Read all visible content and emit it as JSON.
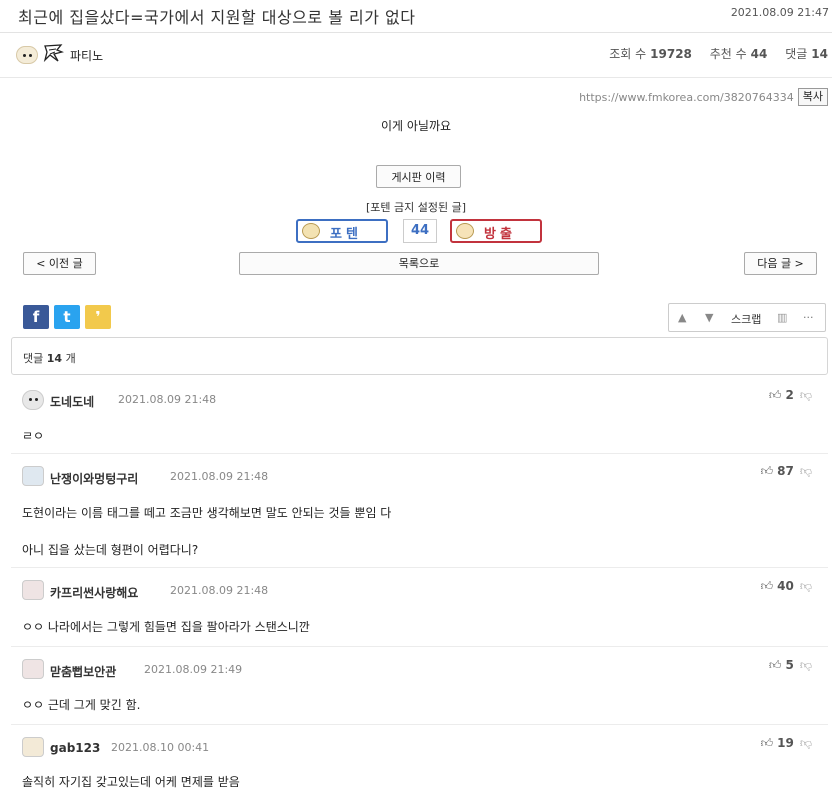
{
  "post": {
    "title": "최근에 집을샀다=국가에서 지원할 대상으로 볼 리가 없다",
    "date": "2021.08.09 21:47",
    "author": "파티노",
    "stats": {
      "views_label": "조회 수",
      "views": "19728",
      "recommend_label": "추천 수",
      "recommend": "44",
      "comments_label": "댓글",
      "comments": "14"
    },
    "url": "https://www.fmkorea.com/3820764334",
    "copy_label": "복사",
    "content": "이게 아닐까요"
  },
  "board_history_label": "게시판 이력",
  "notice": "[포텐 금지 설정된 글]",
  "vote": {
    "up_label": "포텐",
    "count": "44",
    "down_label": "방출"
  },
  "nav": {
    "prev": "< 이전 글",
    "list": "목록으로",
    "next": "다음 글 >"
  },
  "share": {
    "facebook": "f",
    "twitter": "t",
    "kakao": "❜"
  },
  "tools": {
    "up": "▲",
    "down": "▼",
    "scrap": "스크랩",
    "stats": "▥",
    "more": "···"
  },
  "comment_header": {
    "label": "댓글",
    "count": "14",
    "unit": "개"
  },
  "comments": [
    {
      "name": "도네도네",
      "date": "2021.08.09 21:48",
      "votes": "2",
      "body": "ㄹㅇ"
    },
    {
      "name": "난쟁이와멍텅구리",
      "date": "2021.08.09 21:48",
      "votes": "87",
      "body": "도현이라는 이름 태그를 떼고 조금만 생각해보면 말도 안되는 것들 뿐임 다",
      "body2": "아니 집을 샀는데 형편이 어렵다니?"
    },
    {
      "name": "카프리썬사랑해요",
      "date": "2021.08.09 21:48",
      "votes": "40",
      "body": "ㅇㅇ 나라에서는 그렇게 힘들면 집을 팔아라가 스탠스니깐"
    },
    {
      "name": "맏춤뻡보안관",
      "date": "2021.08.09 21:49",
      "votes": "5",
      "body": "ㅇㅇ 근데 그게 맞긴 함."
    },
    {
      "name": "gab123",
      "date": "2021.08.10 00:41",
      "votes": "19",
      "body": "솔직히 자기집 갖고있는데 어케 면제를 받음"
    }
  ],
  "icons": {
    "thumb_up": "thumbs-up-icon",
    "thumb_down": "thumbs-down-icon"
  }
}
